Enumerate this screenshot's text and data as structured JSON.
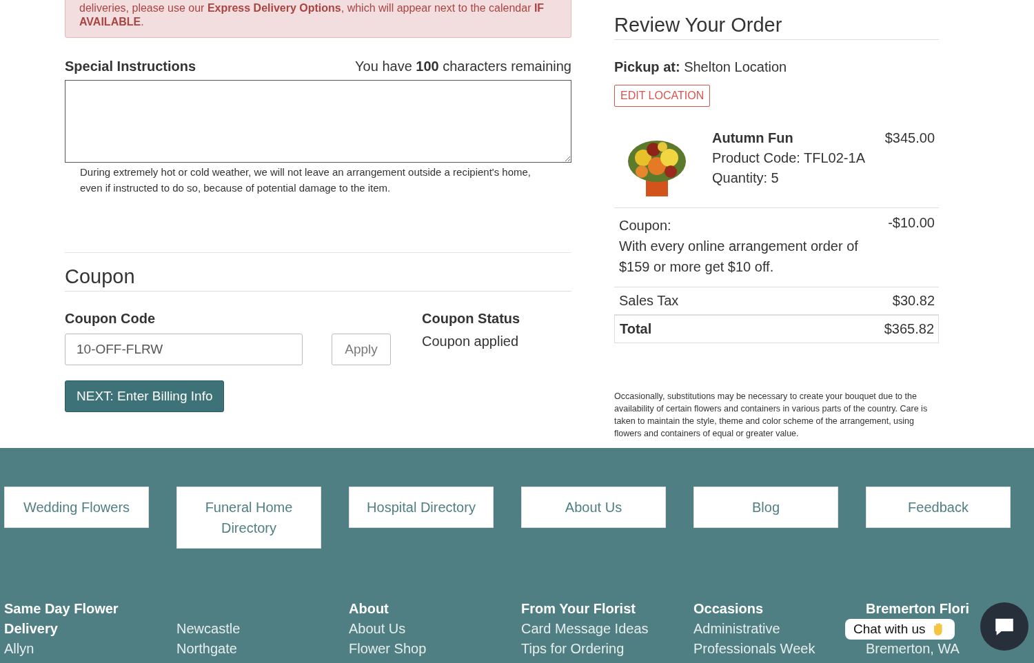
{
  "alert": {
    "text": "deliveries, please use our **Express Delivery Options**, which will appear next to the calendar **IF AVAILABLE**."
  },
  "special_instructions": {
    "label": "Special Instructions",
    "remaining": "You have **100** characters remaining",
    "note": "During extremely hot or cold weather, we will not leave an arrangement outside a recipient's home, even if instructed to do so, because of potential damage to the item."
  },
  "coupon": {
    "title": "Coupon",
    "code_label": "Coupon Code",
    "code_value": "10-OFF-FLRW",
    "apply_button": "Apply",
    "status_label": "Coupon Status",
    "status_value": "Coupon applied",
    "next_button": "NEXT: Enter Billing Info"
  },
  "review": {
    "title": "Review Your Order",
    "pickup_label": "Pickup at:",
    "pickup_value": "Shelton Location",
    "edit_button": "EDIT LOCATION",
    "item": {
      "kind": "picture",
      "name": "Autumn Fun",
      "code": "Product Code: TFL02-1A",
      "quantity": "Quantity: 5",
      "price": "$345.00"
    },
    "coupon": {
      "label": "Coupon:",
      "description": "With every online arrangement order of $159 or more get $10 off.",
      "amount": "-$10.00"
    },
    "tax": {
      "label": "Sales Tax",
      "amount": "$30.82"
    },
    "total": {
      "label": "Total",
      "amount": "$365.82"
    },
    "disclaimer": "Occasionally, substitutions may be necessary to create your bouquet due to the availability of certain flowers and containers in various parts of the country. Care is taken to maintain the style, theme and color scheme of the arrangement, using flowers and containers of equal or greater value."
  },
  "footer": {
    "buttons": [
      "Wedding Flowers",
      "Funeral Home Directory",
      "Hospital Directory",
      "About Us",
      "Blog",
      "Feedback"
    ],
    "columns": [
      {
        "heading": "Same Day Flower Delivery",
        "links": [
          "Allyn"
        ]
      },
      {
        "links": [
          "Newcastle",
          "Northgate"
        ]
      },
      {
        "heading": "About",
        "links": [
          "About Us",
          "Flower Shop"
        ]
      },
      {
        "heading": "From Your Florist",
        "links": [
          "Card Message Ideas",
          "Tips for Ordering"
        ]
      },
      {
        "heading": "Occasions",
        "links": [
          "Administrative Professionals Week"
        ]
      },
      {
        "heading": "Bremerton Flori",
        "links": [
          "Bremerton, WA"
        ]
      }
    ]
  },
  "chat": {
    "label": "Chat with us"
  }
}
